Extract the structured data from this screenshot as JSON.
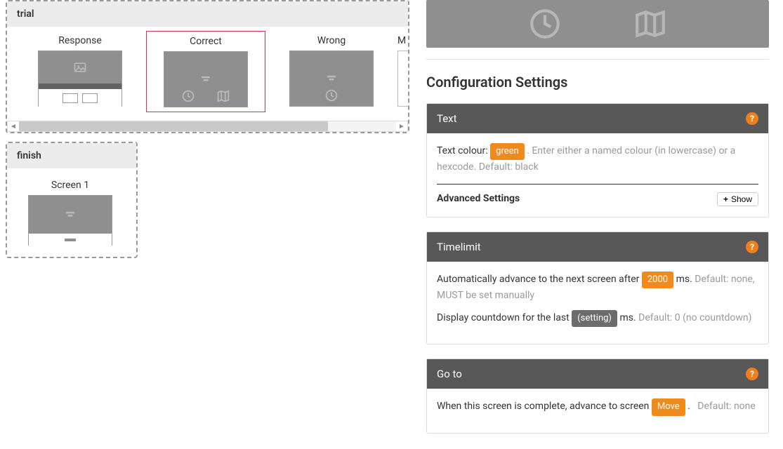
{
  "left": {
    "trial": {
      "title": "trial",
      "cards": [
        {
          "label": "Response"
        },
        {
          "label": "Correct"
        },
        {
          "label": "Wrong"
        },
        {
          "label": "M"
        }
      ]
    },
    "finish": {
      "title": "finish",
      "card_label": "Screen 1"
    }
  },
  "right": {
    "settings_title": "Configuration Settings",
    "text_panel": {
      "title": "Text",
      "label": "Text colour:",
      "value": "green",
      "hint": ". Enter either a named colour (in lowercase) or a hexcode. Default: black",
      "advanced_label": "Advanced Settings",
      "show_label": "Show"
    },
    "timelimit_panel": {
      "title": "Timelimit",
      "line1_pre": "Automatically advance to the next screen after",
      "line1_value": "2000",
      "line1_post": "ms.",
      "line1_hint": "Default: none, MUST be set manually",
      "line2_pre": "Display countdown for the last",
      "line2_value": "(setting)",
      "line2_post": "ms.",
      "line2_hint": "Default: 0 (no countdown)"
    },
    "goto_panel": {
      "title": "Go to",
      "line_pre": "When this screen is complete, advance to screen",
      "line_value": "Move",
      "line_post": ".",
      "line_hint": "Default: none"
    }
  }
}
